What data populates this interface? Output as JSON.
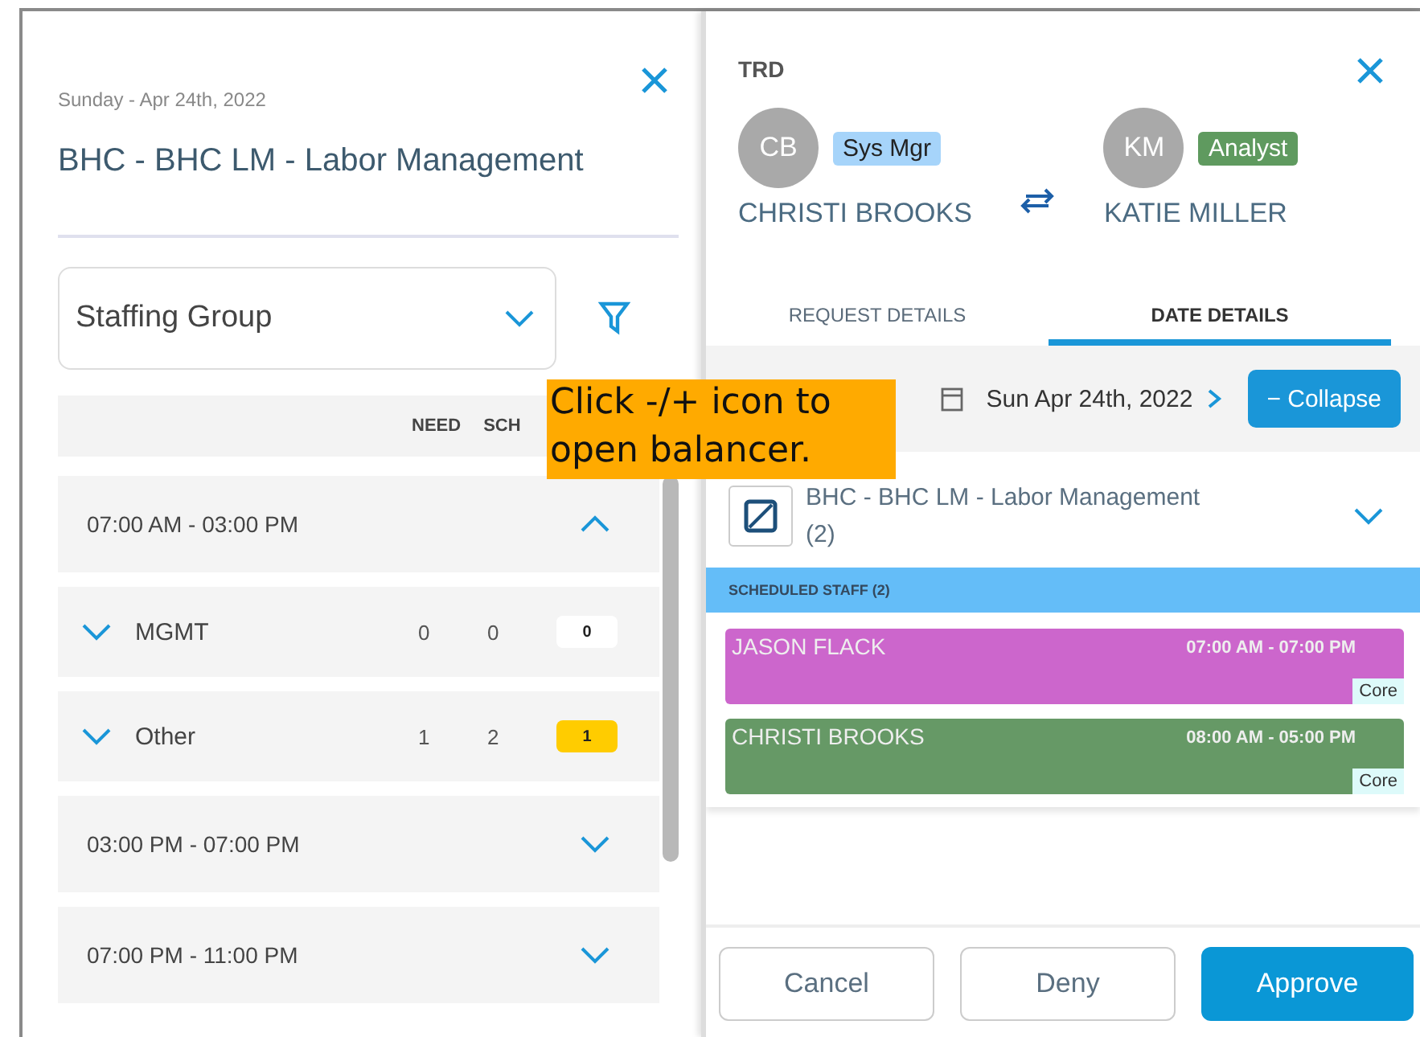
{
  "left_panel": {
    "date": "Sunday - Apr 24th, 2022",
    "title": "BHC - BHC LM - Labor Management",
    "group_select": {
      "value": "Staffing Group"
    },
    "columns": [
      "NEED",
      "SCH"
    ],
    "shifts": [
      {
        "time": "07:00 AM - 03:00 PM",
        "expanded": true,
        "groups": [
          {
            "name": "MGMT",
            "expanded": false,
            "need": "0",
            "sch": "0",
            "balance": "0",
            "color": "#ffffff"
          },
          {
            "name": "Other",
            "expanded": false,
            "need": "1",
            "sch": "2",
            "balance": "1",
            "color": "#ffcc00"
          }
        ]
      },
      {
        "time": "03:00 PM - 07:00 PM",
        "expanded": false
      },
      {
        "time": "07:00 PM - 11:00 PM",
        "expanded": false
      }
    ]
  },
  "right_panel": {
    "type": "TRD",
    "people": [
      {
        "initials": "CB",
        "role": "Sys Mgr",
        "color": "#a6d4fa",
        "name": "CHRISTI BROOKS"
      },
      {
        "initials": "KM",
        "role": "Analyst",
        "color": "#5f9a5f",
        "name": "KATIE MILLER"
      }
    ],
    "tabs": [
      {
        "label": "REQUEST DETAILS",
        "selected": false
      },
      {
        "label": "DATE DETAILS",
        "selected": true
      }
    ],
    "date_bar": {
      "date": "Sun Apr 24th, 2022",
      "collapse_label": "− Collapse"
    },
    "unit": {
      "name": "BHC - BHC LM - Labor Management",
      "count": "(2)",
      "expanded": false
    },
    "scheduled_staff": {
      "heading": "SCHEDULED STAFF (2)",
      "staff": [
        {
          "name": "JASON FLACK",
          "time": "07:00 AM - 07:00 PM",
          "tag": "Core",
          "color": "#cc66cc"
        },
        {
          "name": "CHRISTI BROOKS",
          "time": "08:00 AM - 05:00 PM",
          "tag": "Core",
          "color": "#669966"
        }
      ]
    },
    "buttons": [
      {
        "label": "Cancel",
        "kind": "secondary"
      },
      {
        "label": "Deny",
        "kind": "secondary"
      },
      {
        "label": "Approve",
        "kind": "primary"
      }
    ]
  },
  "callout": {
    "text": "Click -/+ icon to\nopen balancer."
  }
}
